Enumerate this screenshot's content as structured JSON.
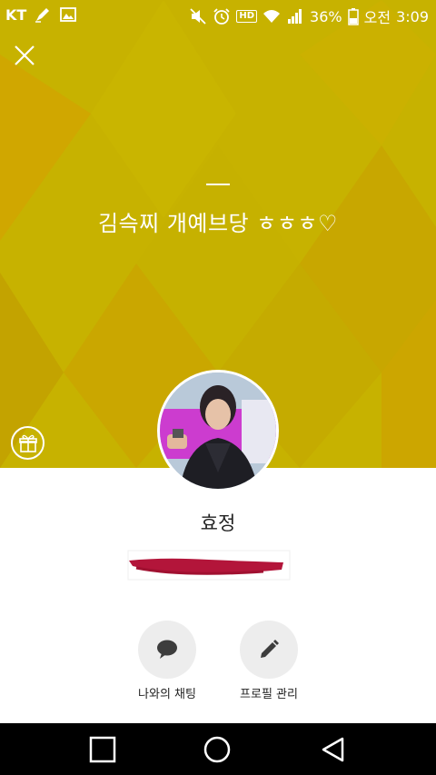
{
  "status_bar": {
    "carrier": "KT",
    "battery_percent": "36%",
    "time_period": "오전",
    "time": "3:09",
    "hd_label": "HD",
    "icons": [
      "pen-icon",
      "image-icon",
      "mute-icon",
      "alarm-icon",
      "hd-icon",
      "wifi-icon",
      "signal-icon",
      "battery-icon"
    ]
  },
  "profile": {
    "status_message": "김슥찌 개예브당 ㅎㅎㅎ♡",
    "name": "효정"
  },
  "actions": [
    {
      "label": "나와의 채팅",
      "icon": "chat-bubble-icon"
    },
    {
      "label": "프로필 관리",
      "icon": "pencil-icon"
    }
  ],
  "colors": {
    "cover": "#c7b200",
    "action_bg": "#ededed",
    "redaction": "#b3153a"
  },
  "nav": {
    "icons": [
      "recent-apps-icon",
      "home-icon",
      "back-icon"
    ]
  }
}
